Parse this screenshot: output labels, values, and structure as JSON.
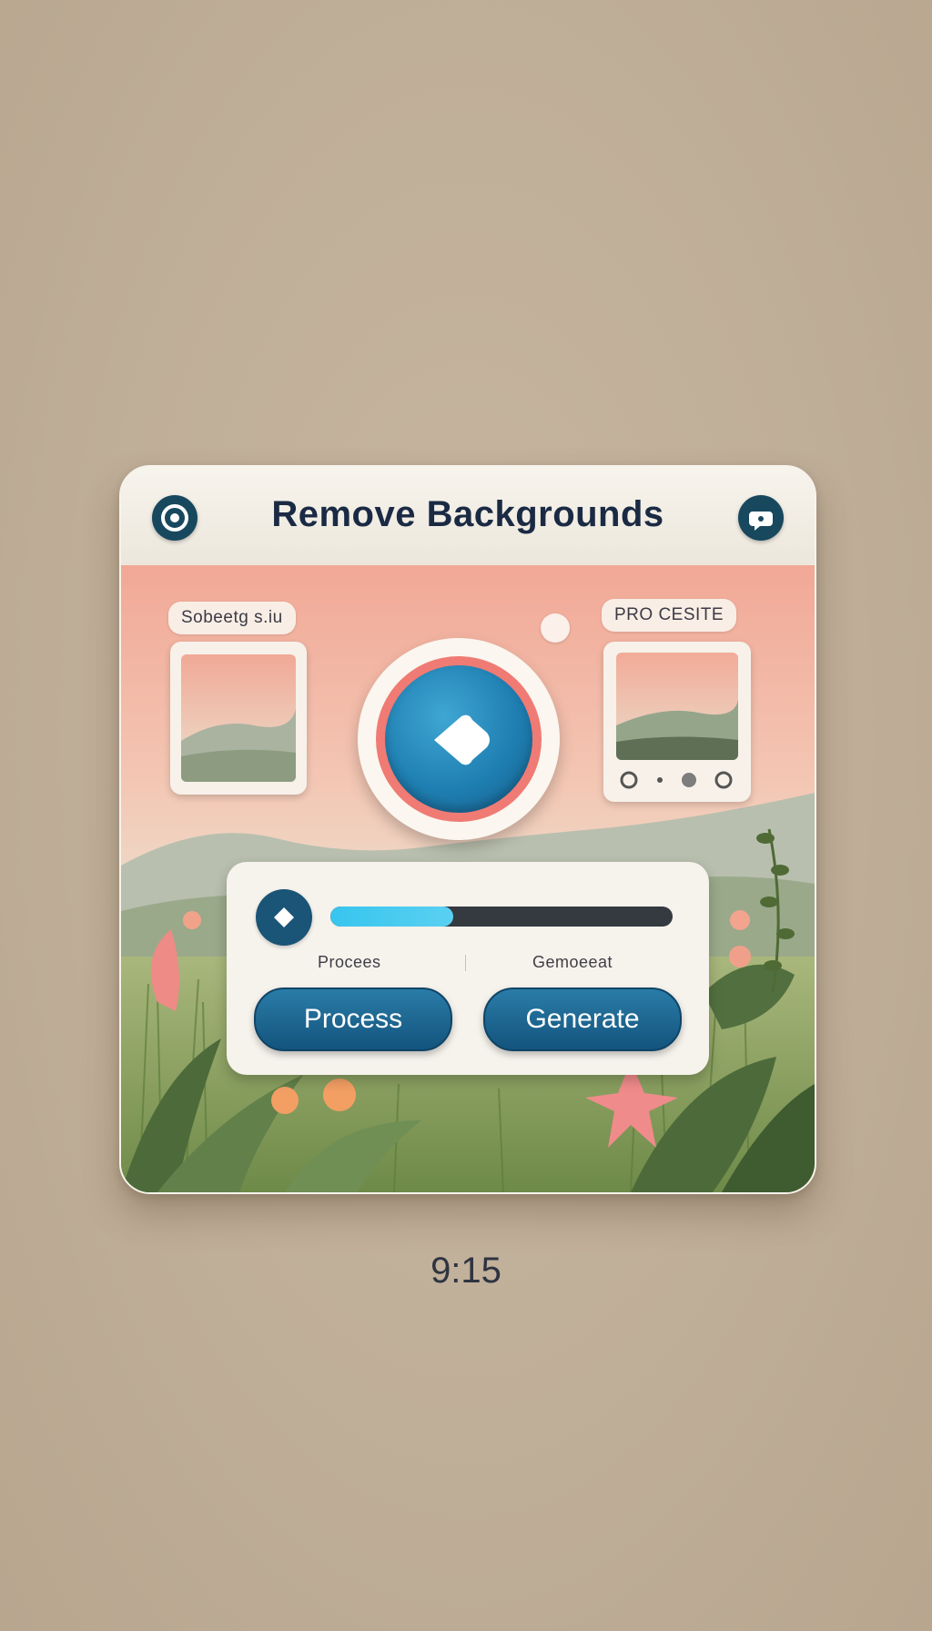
{
  "header": {
    "title": "Remove Backgrounds",
    "left_icon": "target-icon",
    "right_icon": "chat-icon"
  },
  "scene": {
    "left_label": "Sobeetg s.iu",
    "right_label": "PRO CESITE",
    "main_button_icon": "back-arrow-icon"
  },
  "progress": {
    "value": 0.36,
    "left_label": "Procees",
    "right_label": "Gemoeeat"
  },
  "buttons": {
    "process": "Process",
    "generate": "Generate"
  },
  "footer": {
    "time": "9:15"
  },
  "colors": {
    "background": "#c3b29c",
    "accent_blue": "#1f7fb2",
    "progress_fill": "#37c5ee",
    "coral": "#ef7b74",
    "title_text": "#1b2a44"
  }
}
